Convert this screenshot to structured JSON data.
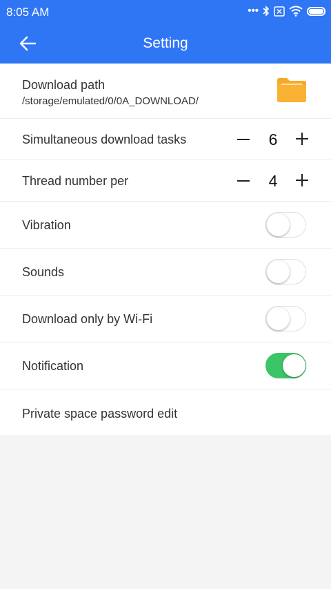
{
  "status_bar": {
    "time": "8:05  AM",
    "icons": [
      "more-dots-icon",
      "bluetooth-icon",
      "sim-x-icon",
      "wifi-icon",
      "battery-icon"
    ]
  },
  "app_bar": {
    "title": "Setting",
    "back_icon": "arrow-left-icon",
    "background": "#2f76f5"
  },
  "settings": {
    "download_path": {
      "label": "Download path",
      "value": "/storage/emulated/0/0A_DOWNLOAD/",
      "icon": "folder-icon",
      "icon_color": "#f7a928"
    },
    "simultaneous_tasks": {
      "label": "Simultaneous download tasks",
      "value": "6"
    },
    "thread_number": {
      "label": "Thread number per",
      "value": "4"
    },
    "vibration": {
      "label": "Vibration",
      "enabled": false
    },
    "sounds": {
      "label": "Sounds",
      "enabled": false
    },
    "wifi_only": {
      "label": "Download only by Wi-Fi",
      "enabled": false
    },
    "notification": {
      "label": "Notification",
      "enabled": true
    },
    "private_password": {
      "label": "Private space password edit"
    }
  },
  "colors": {
    "toggle_on": "#3cc468",
    "page_background": "#f4f4f4"
  }
}
